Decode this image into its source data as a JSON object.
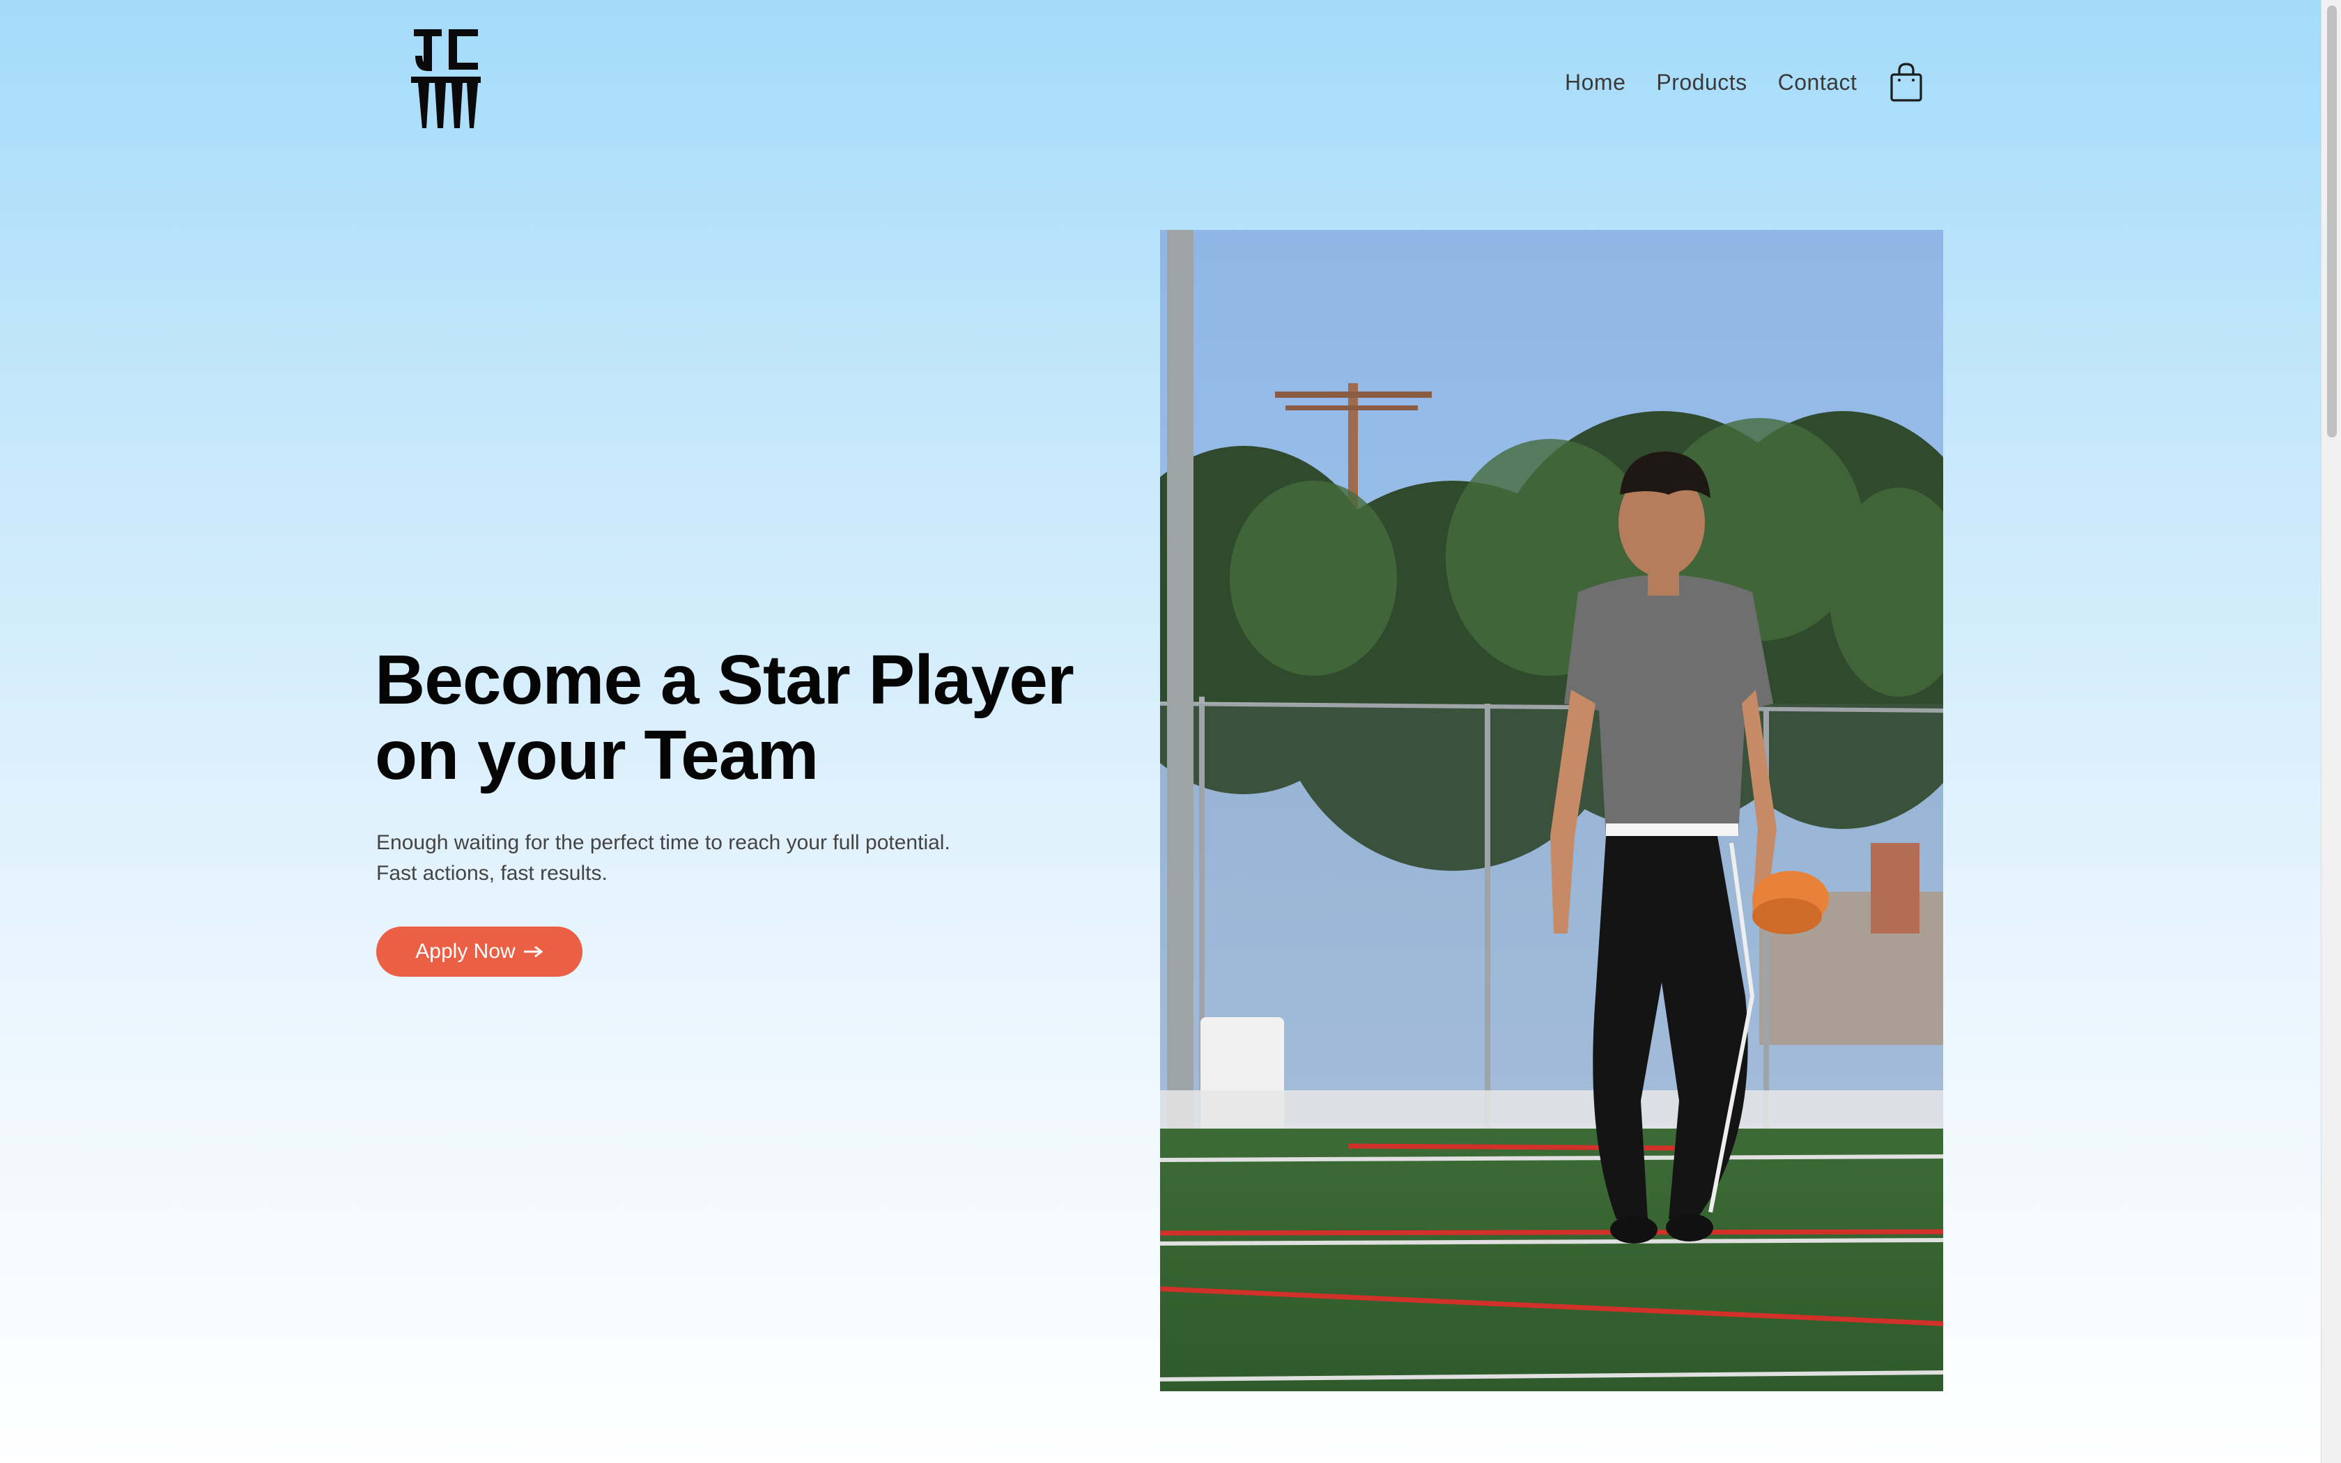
{
  "header": {
    "logo_alt": "JC brand logo",
    "nav": [
      {
        "label": "Home"
      },
      {
        "label": "Products"
      },
      {
        "label": "Contact"
      }
    ],
    "cart_icon": "shopping-bag-icon"
  },
  "hero": {
    "title_line1": "Become a Star Player",
    "title_line2": "on your Team",
    "description_line1": "Enough waiting for the perfect time to reach your full potential.",
    "description_line2": "Fast actions, fast results.",
    "cta_label": "Apply Now",
    "cta_icon": "arrow-right-icon",
    "image": "soccer-player-walking-on-field"
  },
  "colors": {
    "accent": "#eb5f45",
    "sky_top": "#a3dbf9",
    "text_dark": "#050505",
    "text_body": "#444444"
  }
}
